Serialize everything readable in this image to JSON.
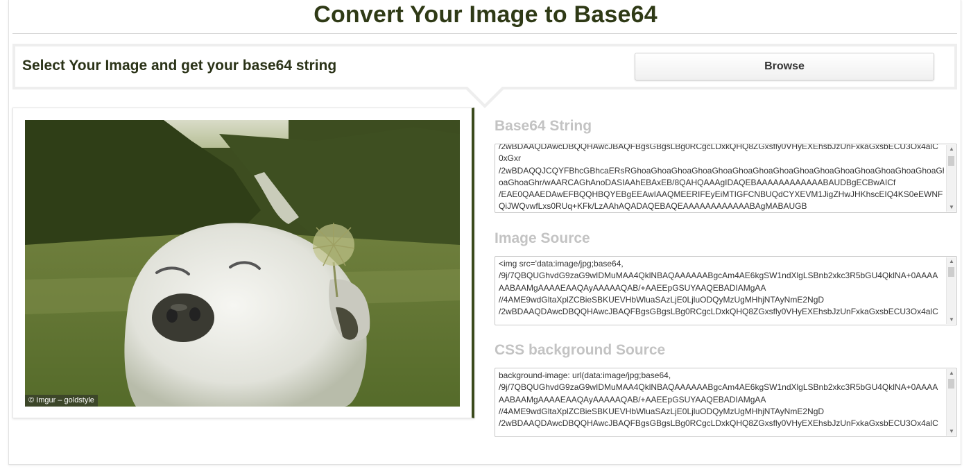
{
  "page": {
    "title": "Convert Your Image to Base64"
  },
  "select_panel": {
    "instruction": "Select Your Image and get your base64 string",
    "browse_label": "Browse"
  },
  "preview": {
    "credit": "© Imgur – goldstyle"
  },
  "outputs": {
    "base64_string": {
      "label": "Base64 String",
      "text": "/2wBDAAQDAwcDBQQHAwcJBAQFBgsGBgsLBg0RCgcLDxkQHQ8ZGxsfly0VHyEXEhsbJzUnFxkaGxsbECU3Ox4alC\n0xGxr\n/2wBDAQQJCQYFBhcGBhcaERsRGhoaGhoaGhoaGhoaGhoaGhoaGhoaGhoaGhoaGhoaGhoaGhoaGhoaGhoaGhoaGh\noaGhoaGhr/wAARCAGhAnoDASIAAhEBAxEB/8QAHQAAAgIDAQEBAAAAAAAAAAAABAUDBgECBwAICf\n/EAE0QAAEDAwEFBQQHBQYEBgEEAwIAAQMEERIFEyEiMTIGFCNBUQdCYXEVM1JigZHwJHKhscEIQ4KS0eEWNF\nQiJWQvwfLxs0RUq+KFk/LzAAhAQADAQEBAQEAAAAAAAAAAAABAgMABAUGB"
    },
    "image_source": {
      "label": "Image Source",
      "text": "<img src='data:image/jpg;base64,\n/9j/7QBQUGhvdG9zaG9wIDMuMAA4QklNBAQAAAAAABgcAm4AE6kgSW1ndXlgLSBnb2xkc3R5bGU4QklNA+0AAAA\nAABAAMgAAAAEAAQAyAAAAAQAB/+AAEEpGSUYAAQEBADIAMgAA\n//4AME9wdGltaXplZCBieSBKUEVHbWluaSAzLjE0LjluODQyMzUgMHhjNTAyNmE2NgD\n/2wBDAAQDAwcDBQQHAwcJBAQFBgsGBgsLBg0RCgcLDxkQHQ8ZGxsfly0VHyEXEhsbJzUnFxkaGxsbECU3Ox4alC"
    },
    "css_source": {
      "label": "CSS background Source",
      "text": "background-image: url(data:image/jpg;base64,\n/9j/7QBQUGhvdG9zaG9wIDMuMAA4QklNBAQAAAAAABgcAm4AE6kgSW1ndXlgLSBnb2xkc3R5bGU4QklNA+0AAAA\nAABAAMgAAAAEAAQAyAAAAAQAB/+AAEEpGSUYAAQEBADIAMgAA\n//4AME9wdGltaXplZCBieSBKUEVHbWluaSAzLjE0LjluODQyMzUgMHhjNTAyNmE2NgD\n/2wBDAAQDAwcDBQQHAwcJBAQFBgsGBgsLBg0RCgcLDxkQHQ8ZGxsfly0VHyEXEhsbJzUnFxkaGxsbECU3Ox4alC"
    }
  },
  "colors": {
    "title": "#2f3a16",
    "accent": "#3b4a1c",
    "section_label": "#c3c3c3"
  },
  "icons": [
    "dog-photo",
    "scroll-up-arrow-icon",
    "scroll-down-arrow-icon"
  ]
}
